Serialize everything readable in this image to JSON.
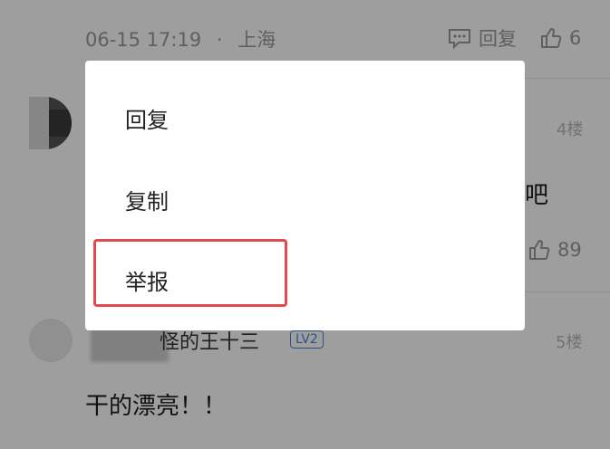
{
  "comment_prev": {
    "timestamp": "06-15 17:19",
    "separator": "·",
    "location": "上海",
    "reply_label": "回复",
    "like_count": "6"
  },
  "comment_4": {
    "floor": "4楼",
    "text_visible_tail": "吧",
    "like_count": "89"
  },
  "comment_5": {
    "username_visible": "怪的王十三",
    "level_badge": "LV2",
    "floor": "5楼",
    "content": "干的漂亮！！"
  },
  "context_menu": {
    "items": [
      {
        "label": "回复"
      },
      {
        "label": "复制"
      },
      {
        "label": "举报"
      }
    ],
    "highlighted_index": 2
  },
  "colors": {
    "highlight_border": "#e24a4f",
    "level_badge": "#4a86d8",
    "overlay": "rgba(0,0,0,0.38)"
  },
  "icons": [
    "comment-icon",
    "thumbs-up-icon"
  ]
}
